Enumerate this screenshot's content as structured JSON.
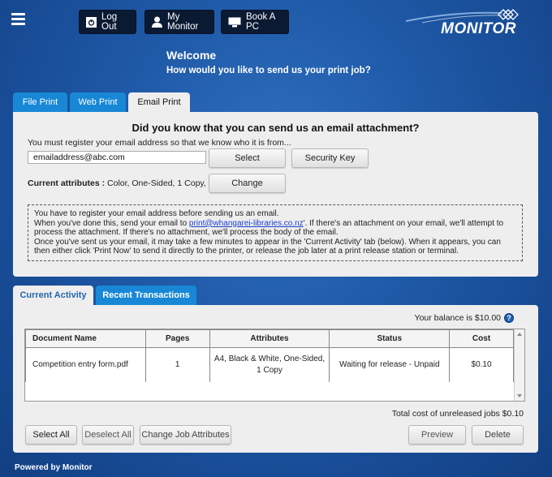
{
  "header": {
    "logout_label": "Log Out",
    "mymonitor_label": "My Monitor",
    "bookpc_label": "Book A PC",
    "logo_text": "MONITOR"
  },
  "welcome": {
    "title": "Welcome",
    "question": "How would you like to send us your print job?"
  },
  "print_tabs": [
    {
      "label": "File Print",
      "active": false
    },
    {
      "label": "Web Print",
      "active": false
    },
    {
      "label": "Email Print",
      "active": true
    }
  ],
  "email_print": {
    "heading": "Did you know that you can send us an email attachment?",
    "register_text": "You must register your email address so that we know who it is from...",
    "email_value": "emailaddress@abc.com",
    "select_label": "Select",
    "security_key_label": "Security Key",
    "attributes_label": "Current attributes :",
    "attributes_value": "Color, One-Sided, 1 Copy,",
    "change_label": "Change",
    "info_line1": "You have to register your email address before sending us an email.",
    "info_line2_pre": "When you've done this, send your email to ",
    "info_email_link": "print@whangarei-libraries.co.nz",
    "info_line2_post": "'. If there's an attachment on your email, we'll attempt to process the attachment. If there's no attachment, we'll process the body of the email.",
    "info_line3": "Once you've sent us your email, it may take a few minutes to appear in the 'Current Activity' tab (below). When it appears, you can then either click 'Print Now' to send it directly to the printer, or release the job later at a print release station or terminal."
  },
  "activity_tabs": [
    {
      "label": "Current Activity",
      "active": true
    },
    {
      "label": "Recent Transactions",
      "active": false
    }
  ],
  "activity": {
    "balance_text": "Your balance is $10.00",
    "help_symbol": "?",
    "columns": [
      "Document Name",
      "Pages",
      "Attributes",
      "Status",
      "Cost"
    ],
    "rows": [
      {
        "document": "Competition entry form.pdf",
        "pages": "1",
        "attributes_line1": "A4, Black & White, One-Sided,",
        "attributes_line2": "1 Copy",
        "status": "Waiting for release - Unpaid",
        "cost": "$0.10"
      }
    ],
    "total_text": "Total cost of unreleased jobs $0.10",
    "select_all_label": "Select All",
    "deselect_all_label": "Deselect All",
    "change_attr_label": "Change Job Attributes",
    "preview_label": "Preview",
    "delete_label": "Delete"
  },
  "footer": {
    "text": "Powered by Monitor"
  },
  "colors": {
    "tab_blue": "#1888d6",
    "panel_bg": "#eeeeee",
    "header_btn": "#0b1a33",
    "bg_blue": "#1f5aa8"
  }
}
